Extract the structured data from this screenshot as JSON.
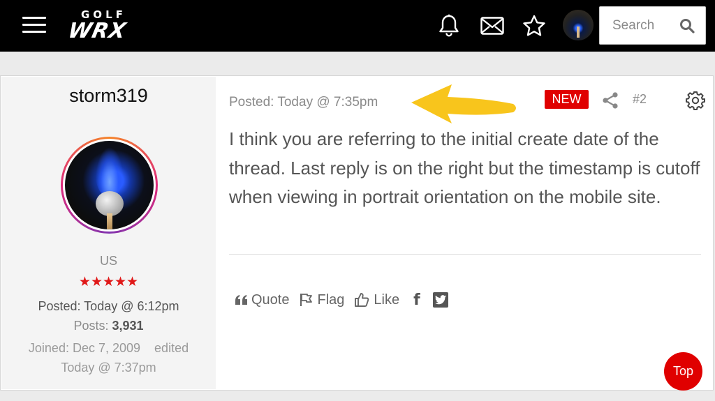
{
  "header": {
    "logo_small": "GOLF",
    "logo_main": "WRX",
    "icons": [
      "menu-icon",
      "bell-icon",
      "mail-icon",
      "star-icon",
      "avatar"
    ],
    "search_placeholder": "Search"
  },
  "author": {
    "username": "storm319",
    "country": "US",
    "stars": "★★★★★",
    "posted": "Posted: Today @ 6:12pm",
    "posts_label": "Posts:",
    "posts_count": "3,931",
    "joined": "Joined:  Dec 7, 2009",
    "edited_label": "edited",
    "edited_time": "Today @ 7:37pm"
  },
  "post": {
    "posted_time": "Posted: Today @ 7:35pm",
    "badge": "NEW",
    "number": "#2",
    "body": "I think you are referring to the initial create date of the thread. Last reply is on the right but the timestamp is cutoff when viewing in portrait orientation on the mobile site.",
    "actions": {
      "quote": "Quote",
      "flag": "Flag",
      "like": "Like",
      "facebook": "f"
    }
  },
  "top_button": "Top",
  "colors": {
    "header_bg": "#000000",
    "accent_red": "#e00000",
    "annotation_arrow": "#f8c51c"
  }
}
